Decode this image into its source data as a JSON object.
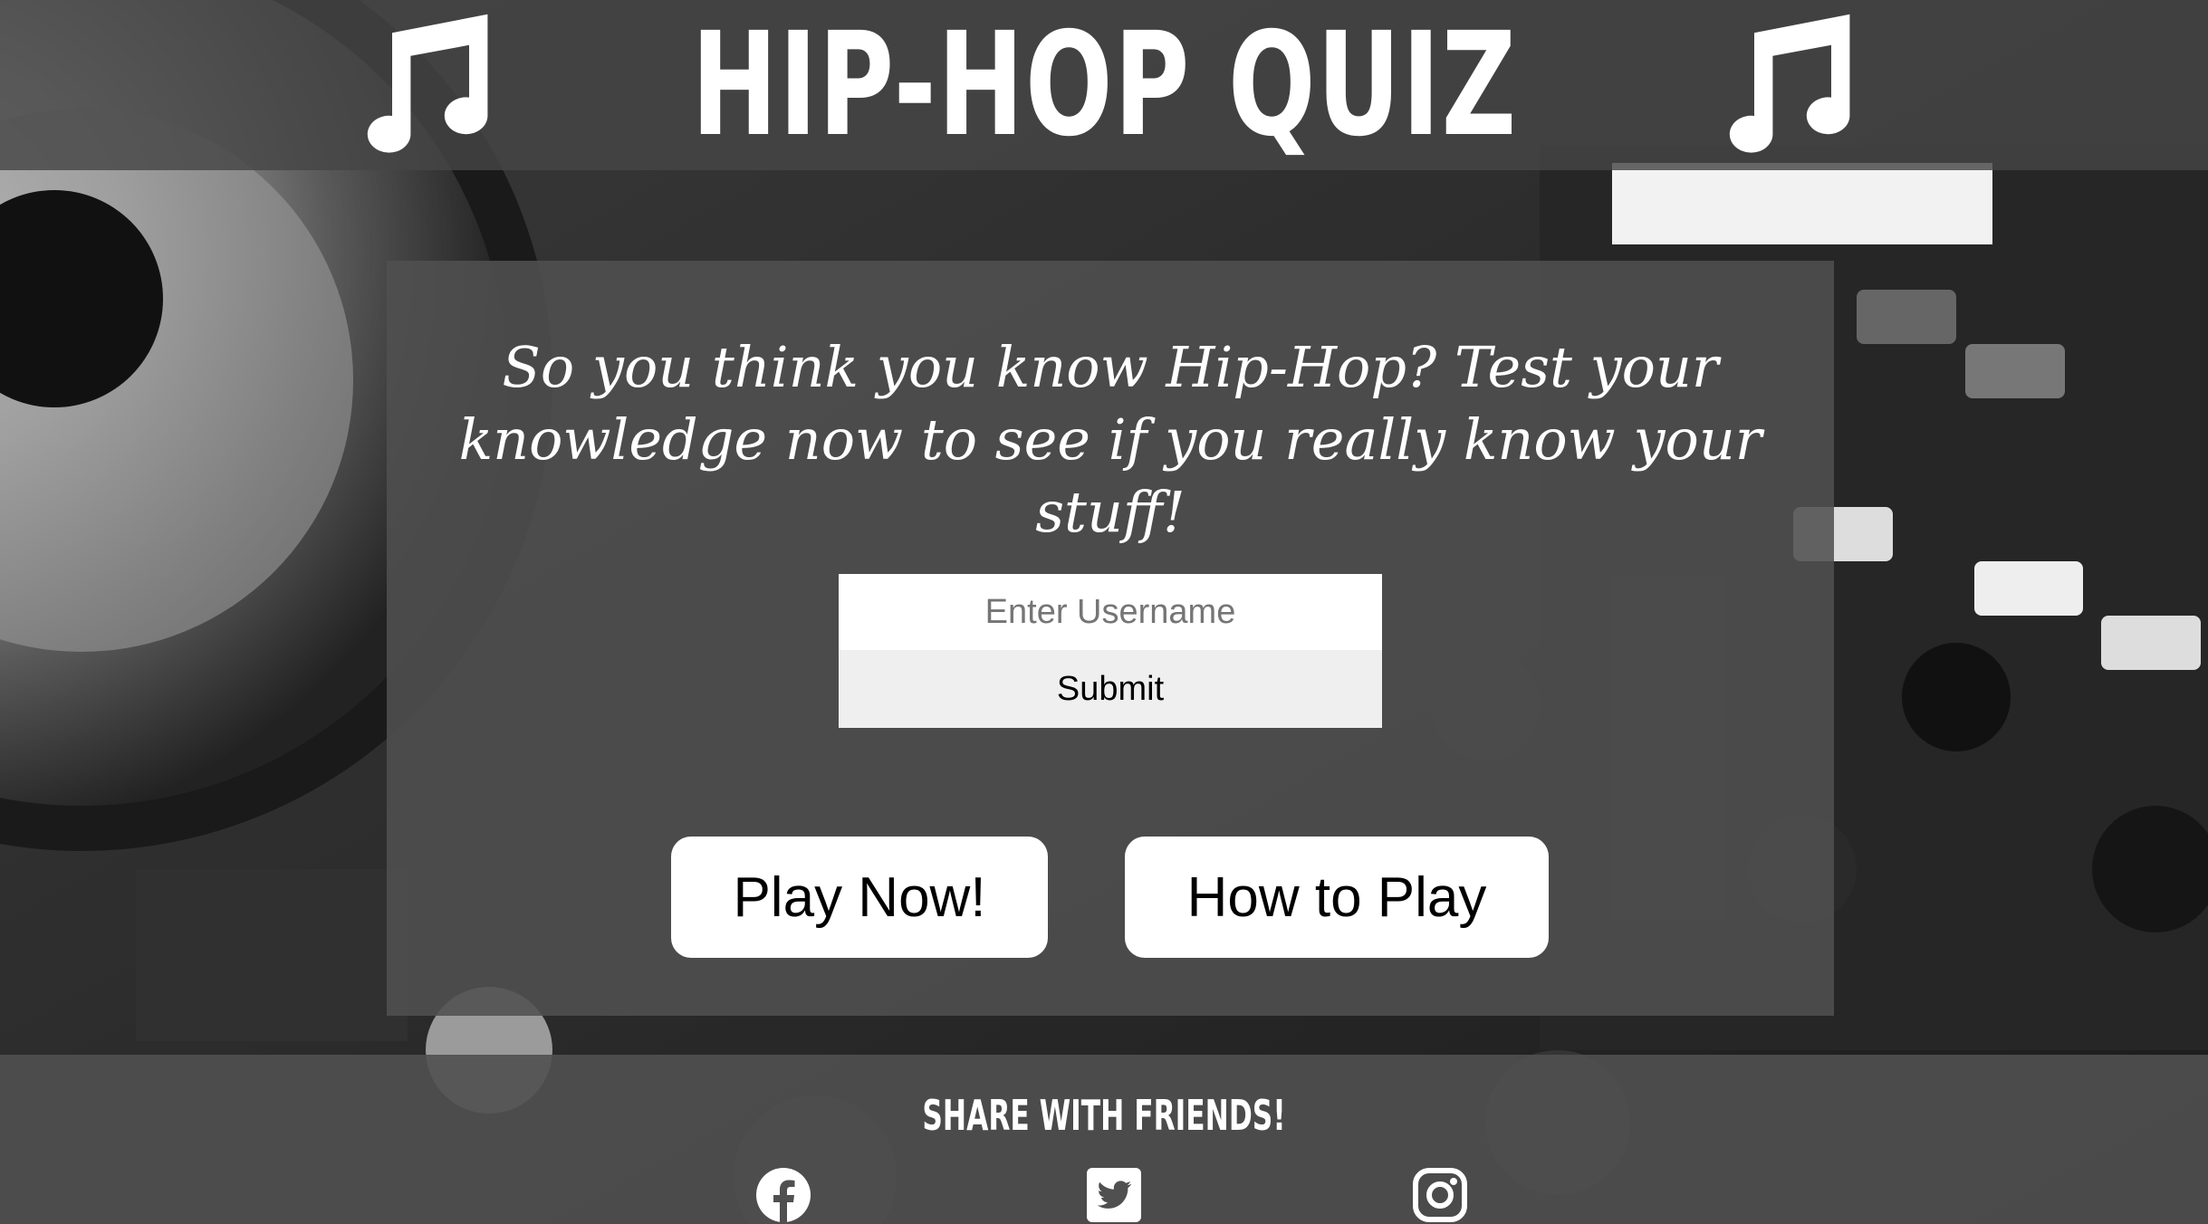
{
  "header": {
    "title": "HIP-HOP QUIZ",
    "left_icon": "music-note-icon",
    "right_icon": "music-note-icon"
  },
  "intro": {
    "text": "So you think you know Hip-Hop? Test your knowledge now to see if you really know your stuff!"
  },
  "username_form": {
    "input_value": "",
    "input_placeholder": "Enter Username",
    "submit_label": "Submit"
  },
  "actions": {
    "play_label": "Play Now!",
    "howto_label": "How to Play"
  },
  "footer": {
    "share_title": "SHARE WITH FRIENDS!",
    "social_icons": [
      "facebook-icon",
      "twitter-icon",
      "instagram-icon"
    ]
  },
  "colors": {
    "header_band": "#464646",
    "card": "#505050",
    "button_bg": "#ffffff",
    "submit_bg": "#efefef",
    "text_light": "#ffffff"
  }
}
